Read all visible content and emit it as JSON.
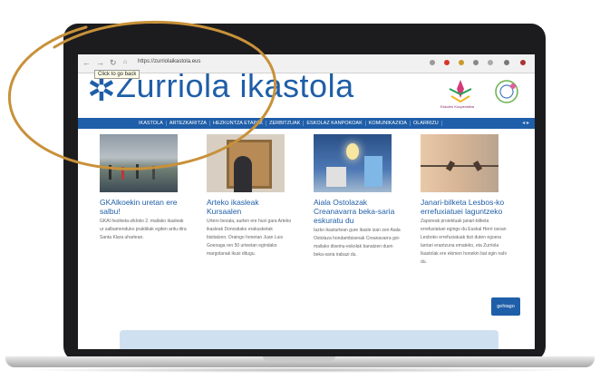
{
  "browser": {
    "url": "https://zurriolaikastola.eus",
    "tooltip": "Click to go back"
  },
  "site": {
    "title": "Zurriola ikastola",
    "partner_label": "Eskolen Kooperatiba"
  },
  "nav": {
    "items": [
      "IKASTOLA",
      "ARTEZKARITZA",
      "HEZKUNTZA ETAPAK",
      "ZERBITZUAK",
      "ESKOLAZ KANPOKOAK",
      "KOMUNIKAZIOA",
      "OLARRIZU"
    ]
  },
  "articles": [
    {
      "title": "GKAlkoekin uretan ere salbu!",
      "body": "GKAI heziketa-zikloko 2. mailako ikasleak ur salbamenduko praktikak egiten aritu dira Santa Klara uhartean."
    },
    {
      "title": "Arteko ikasleak Kursaalen",
      "body": "Urtero bezala, aurten ere huxi gara Arteko ikasleak Donostiako erakusketak bisitatzen. Oraingo honetan Juan Luis Goenaga ren 50 urteetan egindako margolanak ikusi ditugu."
    },
    {
      "title": "Aiala Ostolazak Creanavarra beka-saria eskuratu du",
      "body": "Iazko ikasturtean gure ikasle izan zen Aiala Ostolaza hondambisenak Creanavarra goi-mailako diseinu-eskolak banatzen duen beka-saria irabazi du."
    },
    {
      "title": "Janari-bilketa Lesbos-ko errefuxiatuei laguntzeko",
      "body": "Zaporeak proiektuak janari-bilketa errefuxiatuei egingo du Euskal Herri osoan Lesboko errefuxiatuak bizi duten egoera larriari erantzuna emateko, eta Zurriola Ikastolak ere ekimen honekin bat egin nahi du."
    }
  ],
  "more_button": "gehiago",
  "colors": {
    "brand": "#1f5ea8",
    "scribble": "#c8913a"
  }
}
